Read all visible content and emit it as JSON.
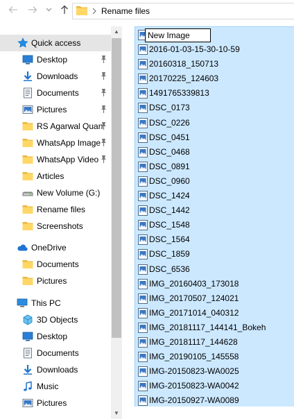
{
  "addressbar": {
    "back_icon": "arrow-left-icon",
    "forward_icon": "arrow-right-icon",
    "recent_icon": "chevron-down-icon",
    "up_icon": "arrow-up-icon",
    "folder_icon": "folder-icon",
    "path": "Rename files"
  },
  "nav": {
    "quick_access": "Quick access",
    "quick_items": [
      {
        "label": "Desktop",
        "icon": "desktop-icon",
        "pinned": true
      },
      {
        "label": "Downloads",
        "icon": "downloads-icon",
        "pinned": true
      },
      {
        "label": "Documents",
        "icon": "documents-icon",
        "pinned": true
      },
      {
        "label": "Pictures",
        "icon": "pictures-icon",
        "pinned": true
      },
      {
        "label": "RS Agarwal Quan",
        "icon": "folder-icon",
        "pinned": true
      },
      {
        "label": "WhatsApp Image",
        "icon": "folder-icon",
        "pinned": true
      },
      {
        "label": "WhatsApp Video",
        "icon": "folder-icon",
        "pinned": true
      },
      {
        "label": "Articles",
        "icon": "folder-icon",
        "pinned": false
      },
      {
        "label": "New Volume (G:)",
        "icon": "drive-icon",
        "pinned": false
      },
      {
        "label": "Rename files",
        "icon": "folder-icon",
        "pinned": false
      },
      {
        "label": "Screenshots",
        "icon": "folder-icon",
        "pinned": false
      }
    ],
    "onedrive": "OneDrive",
    "onedrive_items": [
      {
        "label": "Documents",
        "icon": "folder-icon"
      },
      {
        "label": "Pictures",
        "icon": "folder-icon"
      }
    ],
    "thispc": "This PC",
    "thispc_items": [
      {
        "label": "3D Objects",
        "icon": "3d-objects-icon"
      },
      {
        "label": "Desktop",
        "icon": "desktop-icon"
      },
      {
        "label": "Documents",
        "icon": "documents-icon"
      },
      {
        "label": "Downloads",
        "icon": "downloads-icon"
      },
      {
        "label": "Music",
        "icon": "music-icon"
      },
      {
        "label": "Pictures",
        "icon": "pictures-icon"
      }
    ]
  },
  "files": {
    "rename_value": "New Image",
    "items": [
      "2016-01-03-15-30-10-59",
      "20160318_150713",
      "20170225_124603",
      "1491765339813",
      "DSC_0173",
      "DSC_0226",
      "DSC_0451",
      "DSC_0468",
      "DSC_0891",
      "DSC_0960",
      "DSC_1424",
      "DSC_1442",
      "DSC_1548",
      "DSC_1564",
      "DSC_1859",
      "DSC_6536",
      "IMG_20160403_173018",
      "IMG_20170507_124021",
      "IMG_20171014_040312",
      "IMG_20181117_144141_Bokeh",
      "IMG_20181117_144628",
      "IMG_20190105_145558",
      "IMG-20150823-WA0025",
      "IMG-20150823-WA0042",
      "IMG-20150927-WA0089"
    ]
  },
  "colors": {
    "selection": "#cce8ff",
    "selection_border": "#99d1ff",
    "hover": "#e5e5e5",
    "folder": "#ffd766",
    "accent": "#0078d7"
  }
}
